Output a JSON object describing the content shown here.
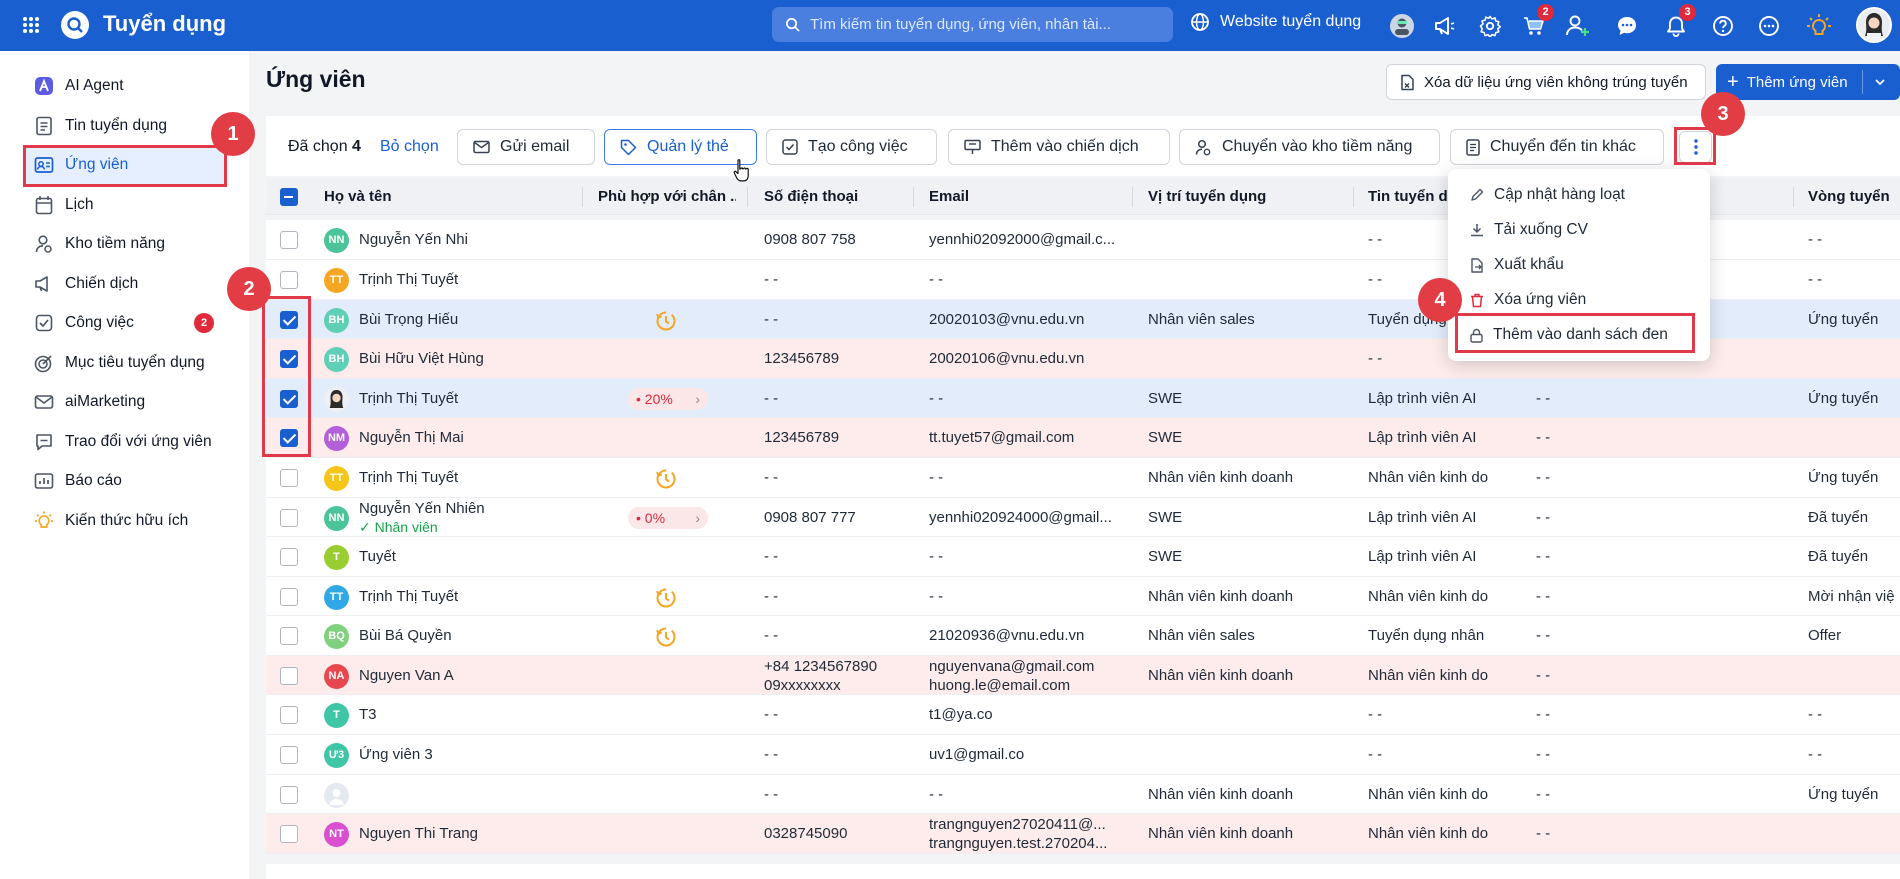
{
  "app": {
    "title": "Tuyển dụng"
  },
  "search": {
    "placeholder": "Tìm kiếm tin tuyển dụng, ứng viên, nhân tài..."
  },
  "topbar": {
    "website_label": "Website tuyển dụng",
    "cart_badge": "2",
    "notif_badge": "3",
    "icons": [
      "apps-grid-icon",
      "avatar-bot-icon",
      "megaphone-icon",
      "gear-icon",
      "cart-icon",
      "add-user-icon",
      "chat-icon",
      "bell-icon",
      "help-icon",
      "more-circle-icon",
      "lightbulb-icon",
      "user-avatar"
    ]
  },
  "sidebar": {
    "items": [
      {
        "label": "AI Agent",
        "icon": "ai-agent-icon"
      },
      {
        "label": "Tin tuyển dụng",
        "icon": "document-icon"
      },
      {
        "label": "Ứng viên",
        "icon": "id-card-icon",
        "active": true
      },
      {
        "label": "Lịch",
        "icon": "calendar-icon"
      },
      {
        "label": "Kho tiềm năng",
        "icon": "talent-pool-icon"
      },
      {
        "label": "Chiến dịch",
        "icon": "megaphone-icon"
      },
      {
        "label": "Công việc",
        "icon": "task-icon",
        "badge": "2"
      },
      {
        "label": "Mục tiêu tuyển dụng",
        "icon": "target-icon"
      },
      {
        "label": "aiMarketing",
        "icon": "mail-icon"
      },
      {
        "label": "Trao đổi với ứng viên",
        "icon": "chat-icon"
      },
      {
        "label": "Báo cáo",
        "icon": "report-icon"
      },
      {
        "label": "Kiến thức hữu ích",
        "icon": "lightbulb-icon"
      }
    ]
  },
  "page": {
    "title": "Ứng viên",
    "clear_button": "Xóa dữ liệu ứng viên không trúng tuyển",
    "add_button": "Thêm ứng viên"
  },
  "toolbar": {
    "selected_prefix": "Đã chọn",
    "selected_count": "4",
    "deselect": "Bỏ chọn",
    "send_email": "Gửi email",
    "manage_tags": "Quản lý thẻ",
    "create_task": "Tạo công việc",
    "add_campaign": "Thêm vào chiến dịch",
    "move_pool": "Chuyển vào kho tiềm năng",
    "move_job": "Chuyển đến tin khác"
  },
  "more_menu": {
    "items": [
      "Cập nhật hàng loạt",
      "Tải xuống CV",
      "Xuất khẩu",
      "Xóa ứng viên",
      "Thêm vào danh sách đen"
    ]
  },
  "markers": [
    "1",
    "2",
    "3",
    "4"
  ],
  "table": {
    "columns": [
      "Họ và tên",
      "Phù hợp với chân ...",
      "Số điện thoại",
      "Email",
      "Vị trí tuyển dụng",
      "Tin tuyển d",
      "Vòng tuyển"
    ],
    "rows": [
      {
        "initials": "NN",
        "avatar_color": "#4cc49a",
        "name": "Nguyễn Yến Nhi",
        "phone": "0908 807 758",
        "email": "yennhi02092000@gmail.c...",
        "position": "",
        "job": "- -",
        "col7": "",
        "round": "- -",
        "checked": false,
        "tint": ""
      },
      {
        "initials": "TT",
        "avatar_color": "#f5a623",
        "name": "Trịnh Thị Tuyết",
        "phone": "- -",
        "email": "- -",
        "position": "",
        "job": "- -",
        "col7": "",
        "round": "- -",
        "checked": false,
        "tint": ""
      },
      {
        "initials": "BH",
        "avatar_color": "#5fcfb6",
        "name": "Bùi Trọng Hiếu",
        "match": "clock",
        "phone": "- -",
        "email": "20020103@vnu.edu.vn",
        "position": "Nhân viên sales",
        "job": "Tuyển dụng",
        "col7": "",
        "round": "Ứng tuyển",
        "checked": true,
        "tint": "blue"
      },
      {
        "initials": "BH",
        "avatar_color": "#5fcfb6",
        "name": "Bùi Hữu Việt Hùng",
        "phone": "123456789",
        "email": "20020106@vnu.edu.vn",
        "position": "",
        "job": "- -",
        "col7": "",
        "round": "",
        "checked": true,
        "tint": "pink"
      },
      {
        "initials": "",
        "avatar_color": "photo",
        "name": "Trịnh Thị Tuyết",
        "match_pct": "20%",
        "phone": "- -",
        "email": "- -",
        "position": "SWE",
        "job": "Lập trình viên AI",
        "col7": "- -",
        "round": "Ứng tuyển",
        "checked": true,
        "tint": "blue"
      },
      {
        "initials": "NM",
        "avatar_color": "#b25fd9",
        "name": "Nguyễn Thị Mai",
        "phone": "123456789",
        "email": "tt.tuyet57@gmail.com",
        "position": "SWE",
        "job": "Lập trình viên AI",
        "col7": "- -",
        "round": "",
        "checked": true,
        "tint": "pink"
      },
      {
        "initials": "TT",
        "avatar_color": "#f5c518",
        "name": "Trịnh Thị Tuyết",
        "match": "clock",
        "phone": "- -",
        "email": "- -",
        "position": "Nhân viên kinh doanh",
        "job": "Nhân viên kinh doan",
        "col7": "- -",
        "round": "Ứng tuyển",
        "checked": false,
        "tint": ""
      },
      {
        "initials": "NN",
        "avatar_color": "#4cc49a",
        "name": "Nguyễn Yến Nhiên",
        "staff": "Nhân viên",
        "match_pct": "0%",
        "phone": "0908 807 777",
        "email": "yennhi020924000@gmail...",
        "position": "SWE",
        "job": "Lập trình viên AI",
        "col7": "- -",
        "round": "Đã tuyển",
        "checked": false,
        "tint": ""
      },
      {
        "initials": "T",
        "avatar_color": "#9acd32",
        "name": "Tuyết",
        "phone": "- -",
        "email": "- -",
        "position": "SWE",
        "job": "Lập trình viên AI",
        "col7": "- -",
        "round": "Đã tuyển",
        "checked": false,
        "tint": ""
      },
      {
        "initials": "TT",
        "avatar_color": "#2fa8e6",
        "name": "Trịnh Thị Tuyết",
        "match": "clock",
        "phone": "- -",
        "email": "- -",
        "position": "Nhân viên kinh doanh",
        "job": "Nhân viên kinh doan",
        "col7": "- -",
        "round": "Mời nhận việ",
        "checked": false,
        "tint": ""
      },
      {
        "initials": "BQ",
        "avatar_color": "#7fd17f",
        "name": "Bùi Bá Quyền",
        "match": "clock",
        "phone": "- -",
        "email": "21020936@vnu.edu.vn",
        "position": "Nhân viên sales",
        "job": "Tuyển dụng nhân viê",
        "col7": "- -",
        "round": "Offer",
        "checked": false,
        "tint": ""
      },
      {
        "initials": "NA",
        "avatar_color": "#e8474f",
        "name": "Nguyen Van A",
        "phone": "+84 1234567890",
        "phone2": "09xxxxxxxx",
        "email": "nguyenvana@gmail.com",
        "email2": "huong.le@email.com",
        "position": "Nhân viên kinh doanh",
        "job": "Nhân viên kinh doan",
        "col7": "- -",
        "round": "",
        "checked": false,
        "tint": "pink"
      },
      {
        "initials": "T",
        "avatar_color": "#3fc6a6",
        "name": "T3",
        "phone": "- -",
        "email": "t1@ya.co",
        "position": "",
        "job": "- -",
        "col7": "- -",
        "round": "- -",
        "checked": false,
        "tint": ""
      },
      {
        "initials": "Ư3",
        "avatar_color": "#3fc6a6",
        "name": "Ứng viên 3",
        "phone": "- -",
        "email": "uv1@gmail.co",
        "position": "",
        "job": "- -",
        "col7": "- -",
        "round": "- -",
        "checked": false,
        "tint": ""
      },
      {
        "initials": "",
        "avatar_color": "blank",
        "name": "",
        "phone": "- -",
        "email": "- -",
        "position": "Nhân viên kinh doanh",
        "job": "Nhân viên kinh doan",
        "col7": "- -",
        "round": "Ứng tuyển",
        "checked": false,
        "tint": ""
      },
      {
        "initials": "NT",
        "avatar_color": "#d94fd0",
        "name": "Nguyen Thi Trang",
        "phone": "0328745090",
        "email": "trangnguyen27020411@...",
        "email2": "trangnguyen.test.270204...",
        "position": "Nhân viên kinh doanh",
        "job": "Nhân viên kinh doan",
        "col7": "- -",
        "round": "",
        "checked": false,
        "tint": "pink"
      }
    ]
  }
}
